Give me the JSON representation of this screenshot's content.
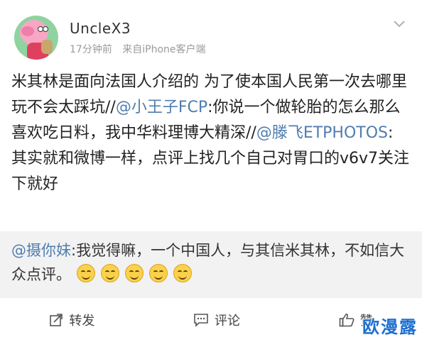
{
  "post": {
    "username": "UncleX3",
    "time": "17分钟前",
    "source": "来自iPhone客户端",
    "body_segments": [
      {
        "type": "text",
        "text": "米其林是面向法国人介绍的 为了使本国人民第一次去哪里玩不会太踩坑//"
      },
      {
        "type": "mention",
        "text": "@小王子FCP"
      },
      {
        "type": "text",
        "text": ":你说一个做轮胎的怎么那么喜欢吃日料，我中华料理博大精深//"
      },
      {
        "type": "mention",
        "text": "@滕飞ETPHOTOS"
      },
      {
        "type": "text",
        "text": ": 其实就和微博一样，点评上找几个自己对胃口的v6v7关注下就好"
      }
    ]
  },
  "repost": {
    "mention": "@摄你妹",
    "text": ":我觉得嘛，一个中国人，与其信米其林，不如信大众点评。",
    "emoji_count": 5,
    "emoji_icon": "grin-emoji-icon"
  },
  "actions": {
    "repost_label": "转发",
    "comment_label": "评论",
    "like_label": "赞",
    "repost_icon": "share-icon",
    "comment_icon": "comment-icon",
    "like_icon": "thumbs-up-icon"
  },
  "watermark": {
    "text": "欧漫露"
  },
  "colors": {
    "mention": "#507daf",
    "repost_bg": "#f2f2f2",
    "meta_gray": "#9a9a9a"
  }
}
